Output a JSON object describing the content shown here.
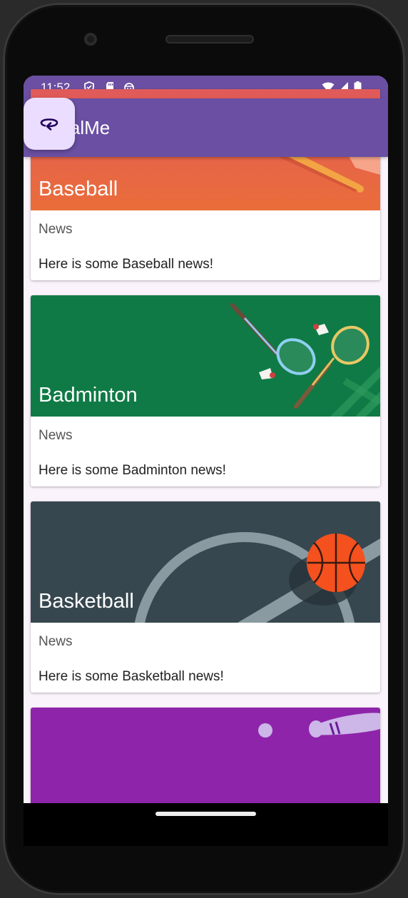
{
  "status_bar": {
    "time": "11:52"
  },
  "app_bar": {
    "title": "erialMe"
  },
  "cards": [
    {
      "title": "Baseball",
      "subtitle": "News",
      "info": "Here is some Baseball news!"
    },
    {
      "title": "Badminton",
      "subtitle": "News",
      "info": "Here is some Badminton news!"
    },
    {
      "title": "Basketball",
      "subtitle": "News",
      "info": "Here is some Basketball news!"
    }
  ],
  "icons": {
    "status": [
      "shield-icon",
      "sd-card-icon",
      "android-robot-icon",
      "wifi-icon",
      "cell-signal-icon",
      "battery-icon"
    ],
    "fab": "rotate-icon"
  },
  "colors": {
    "app_bar": "#6a4fa3",
    "fab": "#eaddff",
    "baseball": "#e5694a",
    "badminton": "#0f7a45",
    "basketball": "#37474f",
    "bowling": "#8e24aa"
  }
}
